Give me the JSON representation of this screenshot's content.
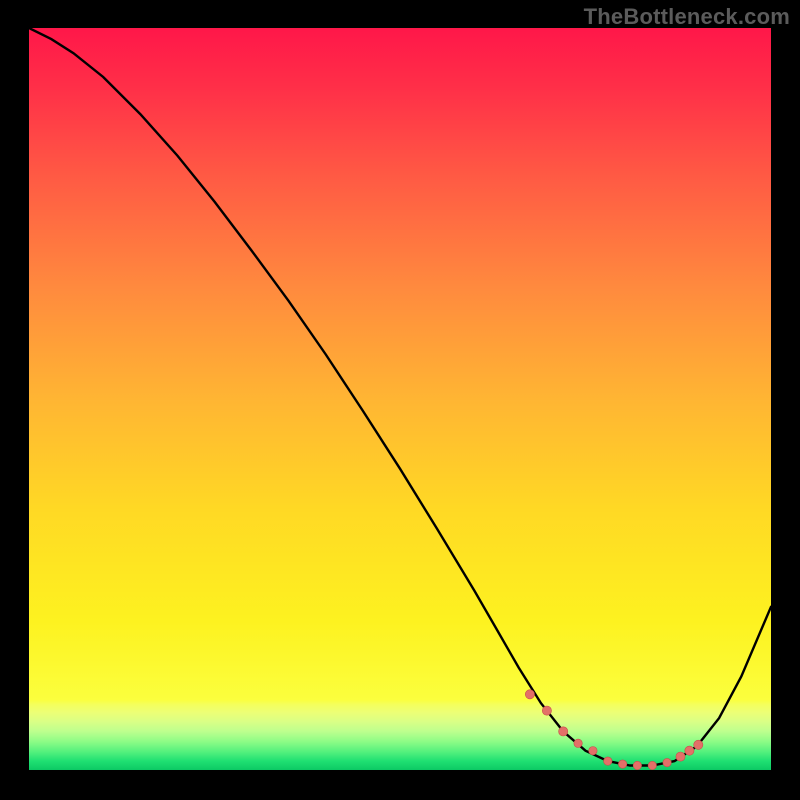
{
  "watermark": "TheBottleneck.com",
  "colors": {
    "curve": "#000000",
    "marker_fill": "#e37068",
    "marker_stroke": "#c84f4a"
  },
  "chart_data": {
    "type": "line",
    "title": "",
    "xlabel": "",
    "ylabel": "",
    "xlim": [
      0,
      100
    ],
    "ylim": [
      0,
      100
    ],
    "x": [
      0,
      3,
      6,
      10,
      15,
      20,
      25,
      30,
      35,
      40,
      45,
      50,
      55,
      60,
      63,
      66,
      69,
      72,
      75,
      78,
      81,
      84,
      87,
      90,
      93,
      96,
      100
    ],
    "y": [
      100,
      98.5,
      96.6,
      93.4,
      88.4,
      82.8,
      76.6,
      70.0,
      63.2,
      56.0,
      48.4,
      40.6,
      32.5,
      24.2,
      19.0,
      13.8,
      9.0,
      5.2,
      2.6,
      1.2,
      0.6,
      0.6,
      1.2,
      3.2,
      7.0,
      12.6,
      22.0
    ],
    "optimal_zone": {
      "x": [
        67.5,
        69.8,
        72.0,
        74.0,
        76.0,
        78.0,
        80.0,
        82.0,
        84.0,
        86.0,
        87.8,
        89.0,
        90.2
      ],
      "y": [
        10.2,
        8.0,
        5.2,
        3.6,
        2.6,
        1.2,
        0.8,
        0.6,
        0.6,
        1.0,
        1.8,
        2.6,
        3.4
      ],
      "radius": [
        4.6,
        4.6,
        4.6,
        4.2,
        4.2,
        4.2,
        4.2,
        4.2,
        4.2,
        4.2,
        4.6,
        4.6,
        4.6
      ]
    }
  }
}
